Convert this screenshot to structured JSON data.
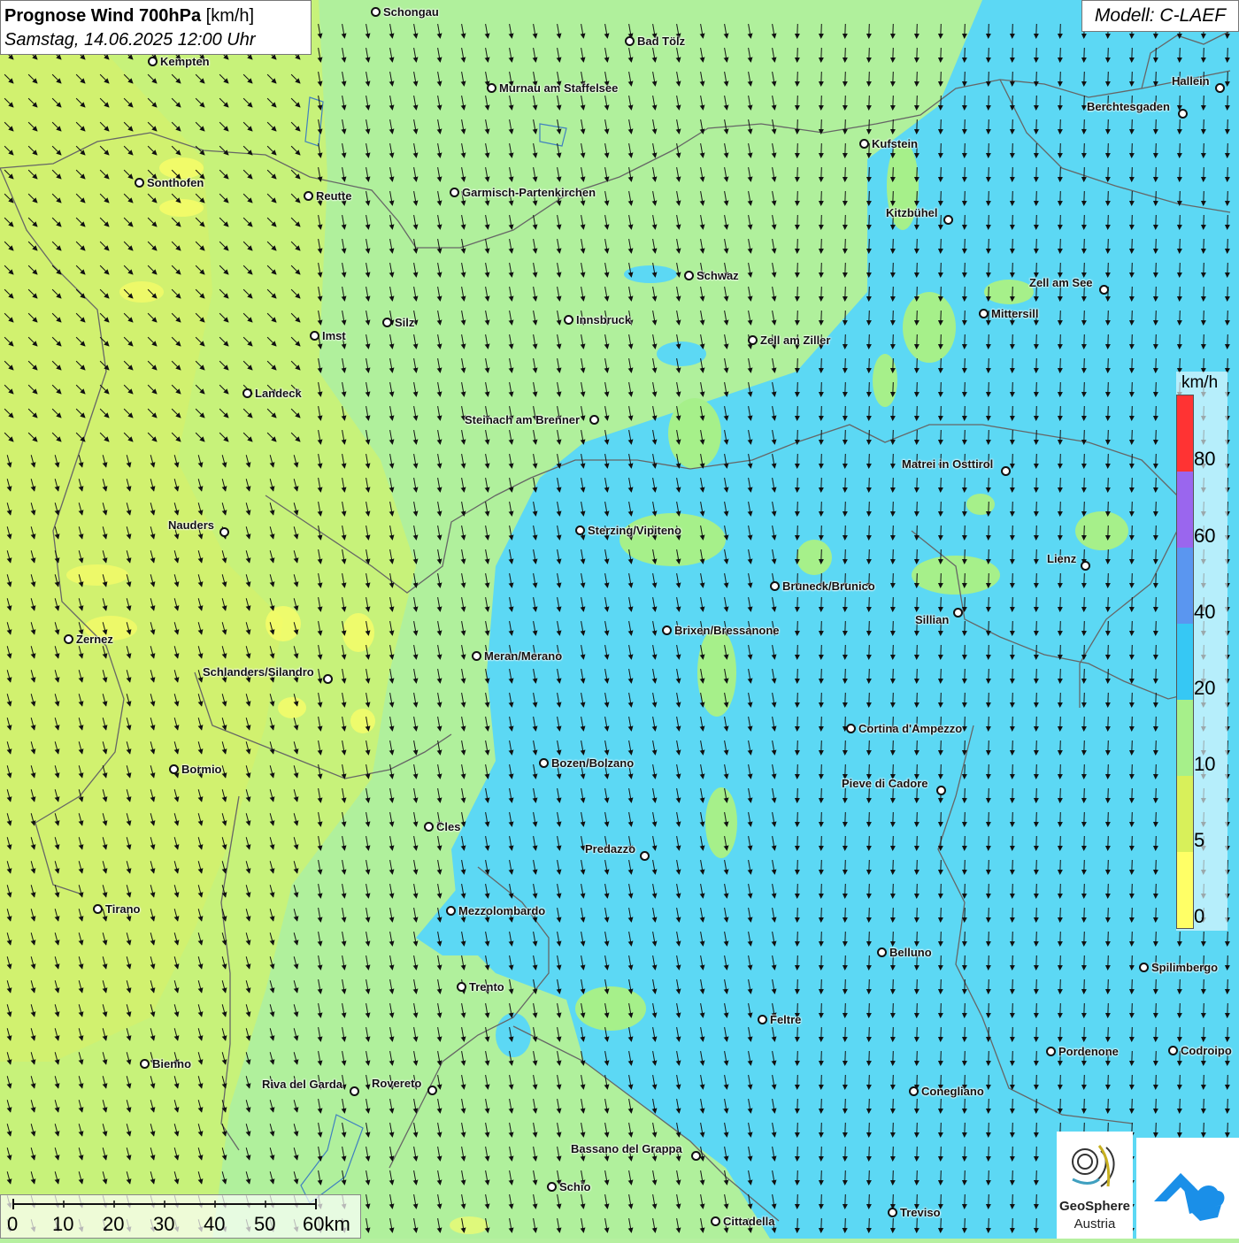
{
  "title": {
    "main": "Prognose Wind 700hPa",
    "unit": "[km/h]",
    "date": "Samstag, 14.06.2025 12:00 Uhr"
  },
  "model": "Modell: C-LAEF",
  "legend": {
    "unit": "km/h",
    "ticks": [
      "80",
      "60",
      "40",
      "20",
      "10",
      "5",
      "0"
    ],
    "colors": [
      "#ff3333",
      "#9a66ee",
      "#5a96f0",
      "#36c8f4",
      "#a6f08a",
      "#d8f05a",
      "#ffff66"
    ]
  },
  "scale": {
    "labels": [
      "0",
      "10",
      "20",
      "30",
      "40",
      "50",
      "60km"
    ]
  },
  "logos": {
    "geosphere_line1": "GeoSphere",
    "geosphere_line2": "Austria"
  },
  "cities": [
    {
      "name": "Schongau"
    },
    {
      "name": "Kempten"
    },
    {
      "name": "Bad Tölz"
    },
    {
      "name": "Murnau am Staffelsee"
    },
    {
      "name": "Hallein"
    },
    {
      "name": "Berchtesgaden"
    },
    {
      "name": "Kufstein"
    },
    {
      "name": "Sonthofen"
    },
    {
      "name": "Reutte"
    },
    {
      "name": "Garmisch-Partenkirchen"
    },
    {
      "name": "Kitzbühel"
    },
    {
      "name": "Schwaz"
    },
    {
      "name": "Zell am See"
    },
    {
      "name": "Mittersill"
    },
    {
      "name": "Silz"
    },
    {
      "name": "Innsbruck"
    },
    {
      "name": "Imst"
    },
    {
      "name": "Zell am Ziller"
    },
    {
      "name": "Landeck"
    },
    {
      "name": "Steinach am Brenner"
    },
    {
      "name": "Matrei in Osttirol"
    },
    {
      "name": "Nauders"
    },
    {
      "name": "Sterzing/Vipiteno"
    },
    {
      "name": "Lienz"
    },
    {
      "name": "Bruneck/Brunico"
    },
    {
      "name": "Sillian"
    },
    {
      "name": "Zernez"
    },
    {
      "name": "Brixen/Bressanone"
    },
    {
      "name": "Meran/Merano"
    },
    {
      "name": "Schlanders/Silandro"
    },
    {
      "name": "Cortina d'Ampezzo"
    },
    {
      "name": "Bozen/Bolzano"
    },
    {
      "name": "Bormio"
    },
    {
      "name": "Pieve di Cadore"
    },
    {
      "name": "Cles"
    },
    {
      "name": "Predazzo"
    },
    {
      "name": "Tirano"
    },
    {
      "name": "Mezzolombardo"
    },
    {
      "name": "Belluno"
    },
    {
      "name": "Spilimbergo"
    },
    {
      "name": "Trento"
    },
    {
      "name": "Feltre"
    },
    {
      "name": "Pordenone"
    },
    {
      "name": "Codroipo"
    },
    {
      "name": "Bienno"
    },
    {
      "name": "Riva del Garda"
    },
    {
      "name": "Rovereto"
    },
    {
      "name": "Conegliano"
    },
    {
      "name": "Bassano del Grappa"
    },
    {
      "name": "Schio"
    },
    {
      "name": "Treviso"
    },
    {
      "name": "Cittadella"
    }
  ]
}
